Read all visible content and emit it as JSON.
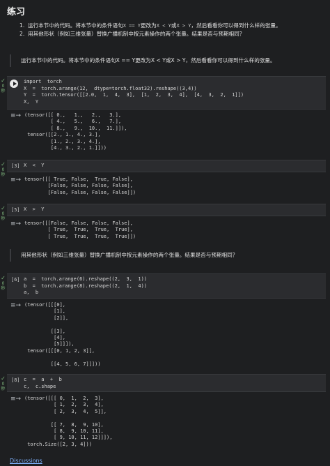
{
  "page": {
    "title": "练习",
    "exercises": [
      {
        "index": "1.",
        "text_before": "运行本节中的代码。将本节中的条件语句",
        "code1": "X == Y",
        "text_mid1": "更改为",
        "code2": "X < Y",
        "text_mid2": "或",
        "code3": "X > Y",
        "text_after": "，然后看看你可以得到什么样的张量。"
      },
      {
        "index": "2.",
        "text": "用其他形状（例如三维张量）替换广播机制中按元素操作的两个张量。结果是否与预期相同？"
      }
    ],
    "md1": "运行本节中的代码。将本节中的条件语句X == Y更改为X < Y或X > Y，然后看看你可以得到什么样的张量。",
    "md2": "用其他形状（例如三维张量）替换广播机制中按元素操作的两个张量。结果是否与预期相同？",
    "check_label": "0 秒",
    "output_icon": "≡→",
    "link": "Discussions"
  },
  "cells": {
    "c1": {
      "prompt": "",
      "lines": [
        "import  torch",
        "X  =  torch.arange(12,  dtype=torch.float32).reshape((3,4))",
        "Y  =  torch.tensor([[2.0,  1,  4,  3],  [1,  2,  3,  4],  [4,  3,  2,  1]])",
        "X,  Y"
      ],
      "output": [
        "(tensor([[ 0.,   1.,   2.,   3.],",
        "         [ 4.,   5.,   6.,   7.],",
        "         [ 8.,   9.,  10.,  11.]]),",
        " tensor([[2., 1., 4., 3.],",
        "         [1., 2., 3., 4.],",
        "         [4., 3., 2., 1.]]))"
      ]
    },
    "c2": {
      "prompt": "[3]",
      "code": "X  <  Y",
      "output": [
        "tensor([[ True, False,  True, False],",
        "        [False, False, False, False],",
        "        [False, False, False, False]])"
      ]
    },
    "c3": {
      "prompt": "[5]",
      "code": "X  >  Y",
      "output": [
        "tensor([[False, False, False, False],",
        "        [ True,  True,  True,  True],",
        "        [ True,  True,  True,  True]])"
      ]
    },
    "c4": {
      "prompt": "[6]",
      "lines": [
        "a  =  torch.arange(6).reshape((2,  3,  1))",
        "b  =  torch.arange(8).reshape((2,  1,  4))",
        "a,  b"
      ],
      "output": [
        "(tensor([[[0],",
        "          [1],",
        "          [2]],",
        "",
        "         [[3],",
        "          [4],",
        "          [5]]]),",
        " tensor([[[0, 1, 2, 3]],",
        "",
        "         [[4, 5, 6, 7]]]))"
      ]
    },
    "c5": {
      "prompt": "[8]",
      "lines": [
        "c  =  a  +  b",
        "c,  c.shape"
      ],
      "output": [
        "(tensor([[[ 0,  1,  2,  3],",
        "          [ 1,  2,  3,  4],",
        "          [ 2,  3,  4,  5]],",
        "",
        "         [[ 7,  8,  9, 10],",
        "          [ 8,  9, 10, 11],",
        "          [ 9, 10, 11, 12]]]),",
        " torch.Size([2, 3, 4]))"
      ]
    }
  }
}
